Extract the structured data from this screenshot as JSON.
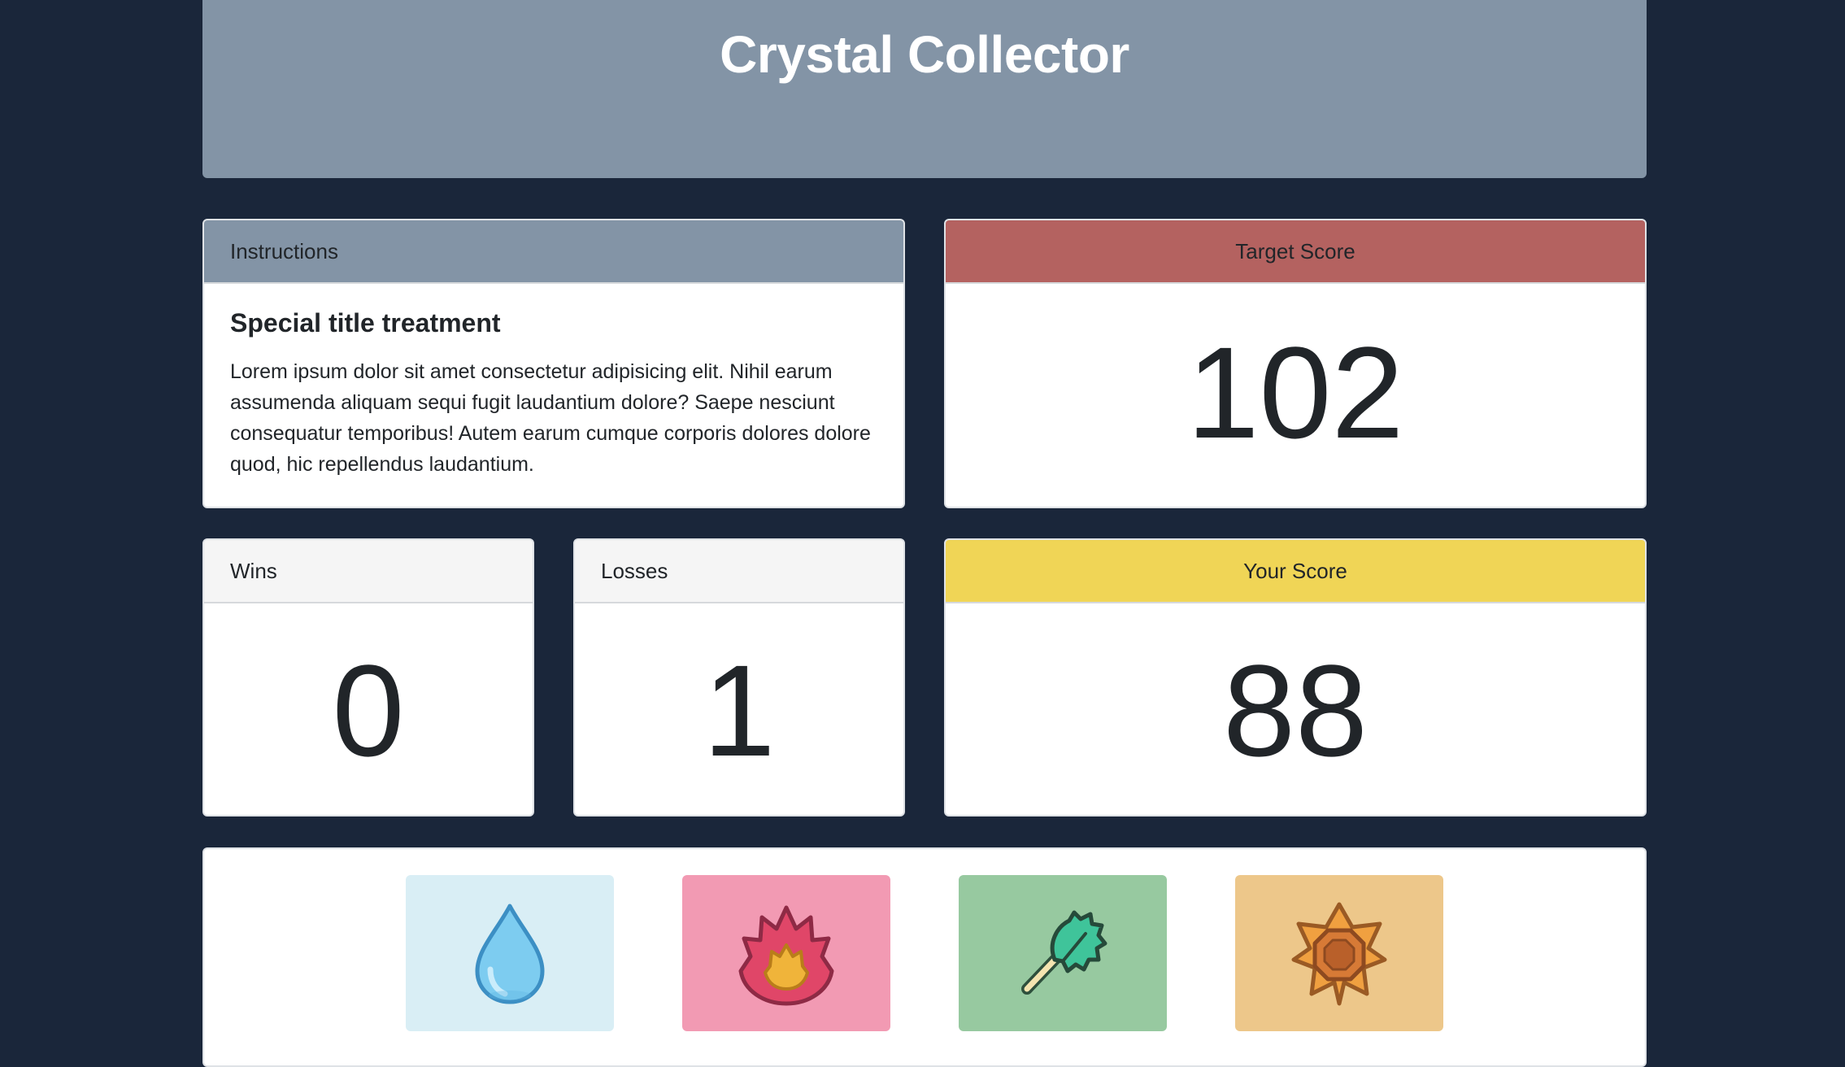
{
  "app": {
    "title": "Crystal Collector"
  },
  "instructions": {
    "header": "Instructions",
    "title": "Special title treatment",
    "text": "Lorem ipsum dolor sit amet consectetur adipisicing elit. Nihil earum assumenda aliquam sequi fugit laudantium dolore? Saepe nesciunt consequatur temporibus! Autem earum cumque corporis dolores dolore quod, hic repellendus laudantium."
  },
  "target": {
    "header": "Target Score",
    "value": "102"
  },
  "wins": {
    "header": "Wins",
    "value": "0"
  },
  "losses": {
    "header": "Losses",
    "value": "1"
  },
  "score": {
    "header": "Your Score",
    "value": "88"
  },
  "crystals": [
    {
      "icon": "water-drop-icon",
      "background": "#d9eef5"
    },
    {
      "icon": "fire-icon",
      "background": "#f29ab3"
    },
    {
      "icon": "leaf-icon",
      "background": "#97c9a0"
    },
    {
      "icon": "earth-gem-icon",
      "background": "#edc78a"
    }
  ],
  "colors": {
    "page_background": "#1a263a",
    "jumbotron": "#8394a6",
    "target_header": "#b46260",
    "score_header": "#f0d556"
  }
}
